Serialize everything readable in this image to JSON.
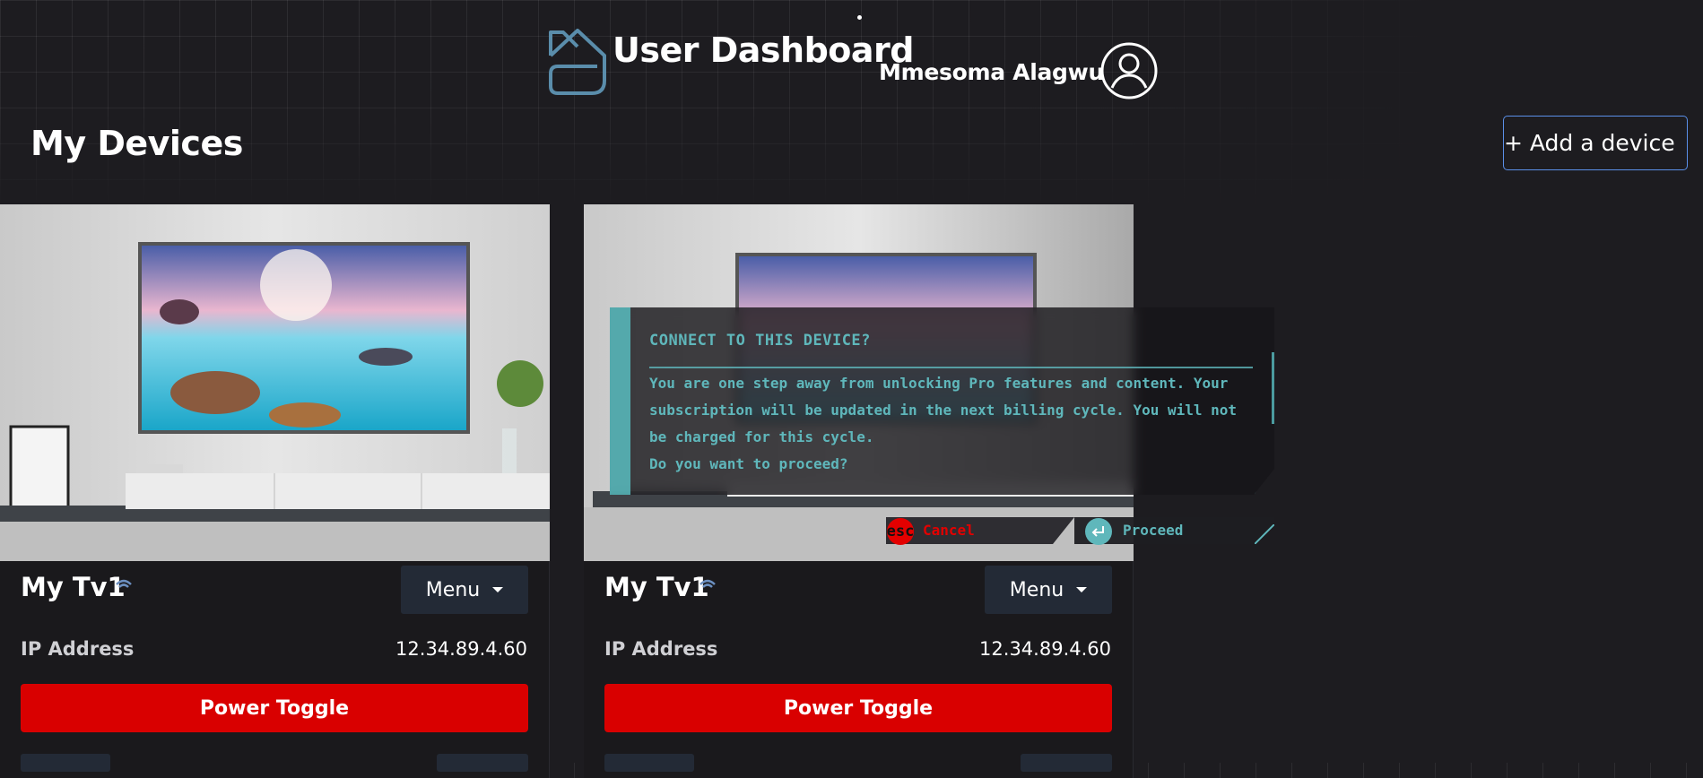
{
  "header": {
    "title": "User Dashboard",
    "user_name": "Mmesoma Alagwu"
  },
  "section": {
    "title": "My Devices",
    "add_device_label": "+ Add a device"
  },
  "devices": [
    {
      "name": "My Tv1",
      "menu_label": "Menu",
      "ip_label": "IP Address",
      "ip_value": "12.34.89.4.60",
      "power_label": "Power Toggle"
    },
    {
      "name": "My Tv1",
      "menu_label": "Menu",
      "ip_label": "IP Address",
      "ip_value": "12.34.89.4.60",
      "power_label": "Power Toggle"
    }
  ],
  "modal": {
    "title": "CONNECT TO THIS DEVICE?",
    "body": "You are one step away from unlocking Pro features and content. Your subscription will be updated in the next billing cycle. You will not be charged for this cycle.",
    "question": "Do you want to proceed?",
    "cancel_key": "esc",
    "cancel_label": "Cancel",
    "proceed_label": "Proceed"
  },
  "colors": {
    "background": "#1d1c20",
    "accent_teal": "#5fb7bb",
    "danger_red": "#d90000",
    "outline_blue": "#5a8fe8",
    "menu_bg": "#232a36"
  },
  "icons": {
    "logo": "house-logo-icon",
    "avatar": "user-avatar-icon",
    "wifi": "wifi-icon",
    "caret": "caret-down-icon",
    "enter": "enter-key-icon"
  }
}
